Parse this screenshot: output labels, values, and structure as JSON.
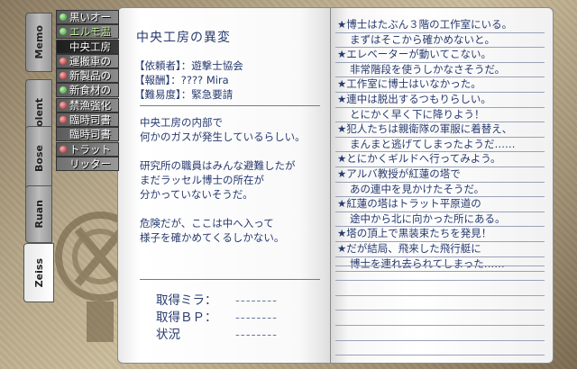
{
  "tabs": [
    "Memo",
    "Rolent",
    "Bose",
    "Ruan",
    "Zeiss"
  ],
  "active_tab_index": 4,
  "scenario_list": [
    {
      "label": "黒いオー",
      "marker": "green",
      "state": "normal"
    },
    {
      "label": "エルモ温",
      "marker": "green",
      "state": "green"
    },
    {
      "label": "中央工房",
      "marker": "none",
      "state": "selected"
    },
    {
      "label": "運搬車の",
      "marker": "red",
      "state": "normal"
    },
    {
      "label": "新製品の",
      "marker": "red",
      "state": "normal"
    },
    {
      "label": "新食材の",
      "marker": "green",
      "state": "normal"
    },
    {
      "label": "禁漁強化",
      "marker": "red",
      "state": "normal"
    },
    {
      "label": "臨時司書",
      "marker": "red",
      "state": "normal"
    },
    {
      "label": "臨時司書",
      "marker": "none",
      "state": "normal"
    },
    {
      "label": "トラット",
      "marker": "red",
      "state": "normal"
    },
    {
      "label": "リッター",
      "marker": "none",
      "state": "gray"
    }
  ],
  "quest": {
    "title": "中央工房の異変",
    "info": [
      {
        "label": "【依頼者】",
        "value": "：遊撃士協会"
      },
      {
        "label": "【報酬】",
        "value": "：???? Mira"
      },
      {
        "label": "【難易度】",
        "value": "：緊急要請"
      }
    ],
    "description": "中央工房の内部で\n何かのガスが発生しているらしい。\n\n研究所の職員はみんな避難したが\nまだラッセル博士の所在が\n分かっていないそうだ。\n\n危険だが、ここは中へ入って\n様子を確かめてくるしかない。",
    "rewards": [
      {
        "label": "取得ミラ：",
        "value": "--------"
      },
      {
        "label": "取得ＢＰ：",
        "value": "--------"
      },
      {
        "label": "状況",
        "value": "--------"
      }
    ]
  },
  "notes": [
    {
      "text": "★博士はたぶん３階の工作室にいる。",
      "indent": false
    },
    {
      "text": "まずはそこから確かめないと。",
      "indent": true
    },
    {
      "text": "★エレベーターが動いてこない。",
      "indent": false
    },
    {
      "text": "非常階段を使うしかなさそうだ。",
      "indent": true
    },
    {
      "text": "★工作室に博士はいなかった。",
      "indent": false
    },
    {
      "text": "★連中は脱出するつもりらしい。",
      "indent": false
    },
    {
      "text": "とにかく早く下に降りよう！",
      "indent": true
    },
    {
      "text": "★犯人たちは親衛隊の軍服に着替え、",
      "indent": false
    },
    {
      "text": "まんまと逃げてしまったようだ……",
      "indent": true
    },
    {
      "text": "★とにかくギルドへ行ってみよう。",
      "indent": false
    },
    {
      "text": "★アルバ教授が紅蓮の塔で",
      "indent": false
    },
    {
      "text": "あの連中を見かけたそうだ。",
      "indent": true
    },
    {
      "text": "★紅蓮の塔はトラット平原道の",
      "indent": false
    },
    {
      "text": "途中から北に向かった所にある。",
      "indent": true
    },
    {
      "text": "★塔の頂上で黒装束たちを発見！",
      "indent": false
    },
    {
      "text": "★だが結局、飛来した飛行艇に",
      "indent": false
    },
    {
      "text": "博士を連れ去られてしまった……",
      "indent": true
    }
  ],
  "colors": {
    "ink": "#273a6e",
    "marker_green": "#2f8b2a",
    "marker_red": "#a51d1d"
  }
}
